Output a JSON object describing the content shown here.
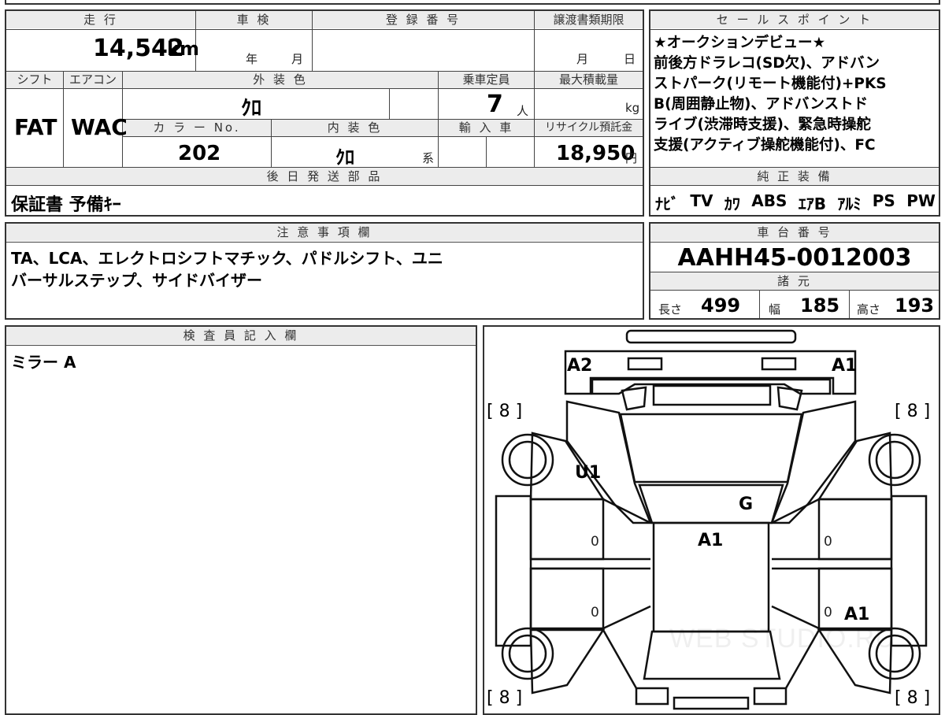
{
  "sheet": {
    "mileage": {
      "label": "走 行",
      "value": "14,542",
      "unit": "km"
    },
    "shaken": {
      "label": "車 検",
      "year_unit": "年",
      "month_unit": "月"
    },
    "registration": {
      "label": "登 録 番 号",
      "value": ""
    },
    "transfer_deadline": {
      "label": "譲渡書類期限",
      "month_unit": "月",
      "day_unit": "日"
    },
    "shift": {
      "label": "シフト",
      "value": "FAT"
    },
    "aircon": {
      "label": "エアコン",
      "value": "WAC"
    },
    "exterior_color": {
      "label": "外 装 色",
      "value": "ｸﾛ"
    },
    "capacity": {
      "label": "乗車定員",
      "value": "7",
      "unit": "人"
    },
    "max_load": {
      "label": "最大積載量",
      "unit": "kg"
    },
    "color_no": {
      "label": "カ ラ ー No.",
      "value": "202"
    },
    "interior_color": {
      "label": "内 装 色",
      "value": "ｸﾛ",
      "suffix": "系"
    },
    "import": {
      "label": "輸 入 車"
    },
    "recycle": {
      "label": "リサイクル預託金",
      "value": "18,950",
      "unit": "円"
    },
    "parts_later": {
      "label": "後 日 発 送 部 品",
      "value": "保証書 予備ｷｰ"
    },
    "sales_points": {
      "label": "セ ー ル ス ポ イ ン ト",
      "lines": [
        "★オークションデビュー★",
        "前後方ドラレコ(SD欠)、アドバン",
        "ストパーク(リモート機能付)+PKS",
        "B(周囲静止物)、アドバンストド",
        "ライブ(渋滞時支援)、緊急時操舵",
        "支援(アクティブ操舵機能付)、FC"
      ]
    },
    "genuine_equipment": {
      "label": "純 正 装 備",
      "items": [
        "ﾅﾋﾞ",
        "TV",
        "ｶﾜ",
        "ABS",
        "ｴｱB",
        "ｱﾙﾐ",
        "PS",
        "PW"
      ]
    },
    "notes": {
      "label": "注 意 事 項 欄",
      "lines": [
        "TA、LCA、エレクトロシフトマチック、パドルシフト、ユニ",
        "バーサルステップ、サイドバイザー"
      ]
    },
    "chassis": {
      "label": "車 台 番 号",
      "value": "AAHH45-0012003"
    },
    "specs": {
      "label": "諸 元",
      "length_label": "長さ",
      "length": "499",
      "width_label": "幅",
      "width": "185",
      "height_label": "高さ",
      "height": "193"
    },
    "inspector": {
      "label": "検 査 員 記 入 欄",
      "value": "ミラー A"
    }
  },
  "diagram": {
    "marks": {
      "front_left": "A2",
      "front_right": "A1",
      "u1": "U1",
      "windshield": "G",
      "roof": "A1",
      "rear_right": "A1",
      "tire_fl": "[ 8 ]",
      "tire_fr": "[ 8 ]",
      "tire_rl": "[ 8 ]",
      "tire_rr": "[ 8 ]",
      "zero": "0"
    },
    "watermark": "WEB STUDIO.RU"
  }
}
